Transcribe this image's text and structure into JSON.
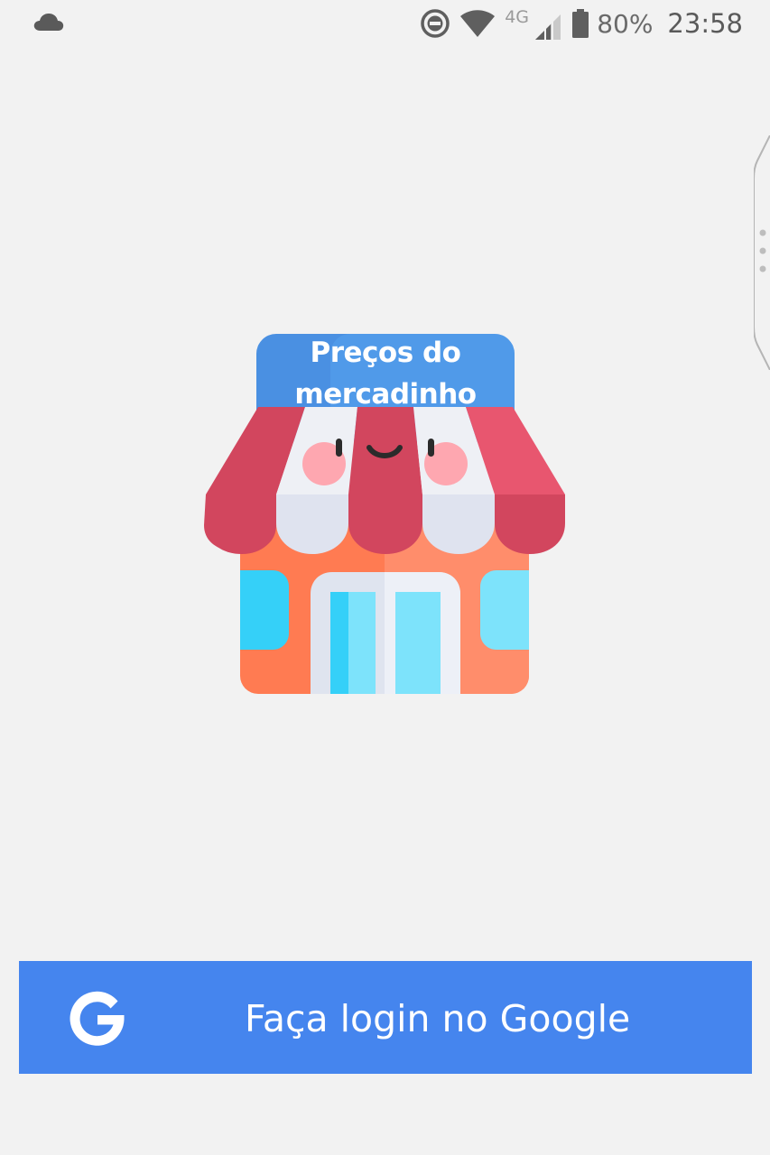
{
  "status_bar": {
    "network_type": "4G",
    "battery_percent": "80%",
    "time": "23:58",
    "icons": [
      "cloud-icon",
      "do-not-disturb-icon",
      "wifi-icon",
      "cell-signal-icon",
      "battery-icon"
    ]
  },
  "logo": {
    "sign_text": "Preços do\nmercadinho"
  },
  "login": {
    "button_label": "Faça login no Google",
    "button_color": "#4585ee",
    "icon": "google-g-icon"
  }
}
